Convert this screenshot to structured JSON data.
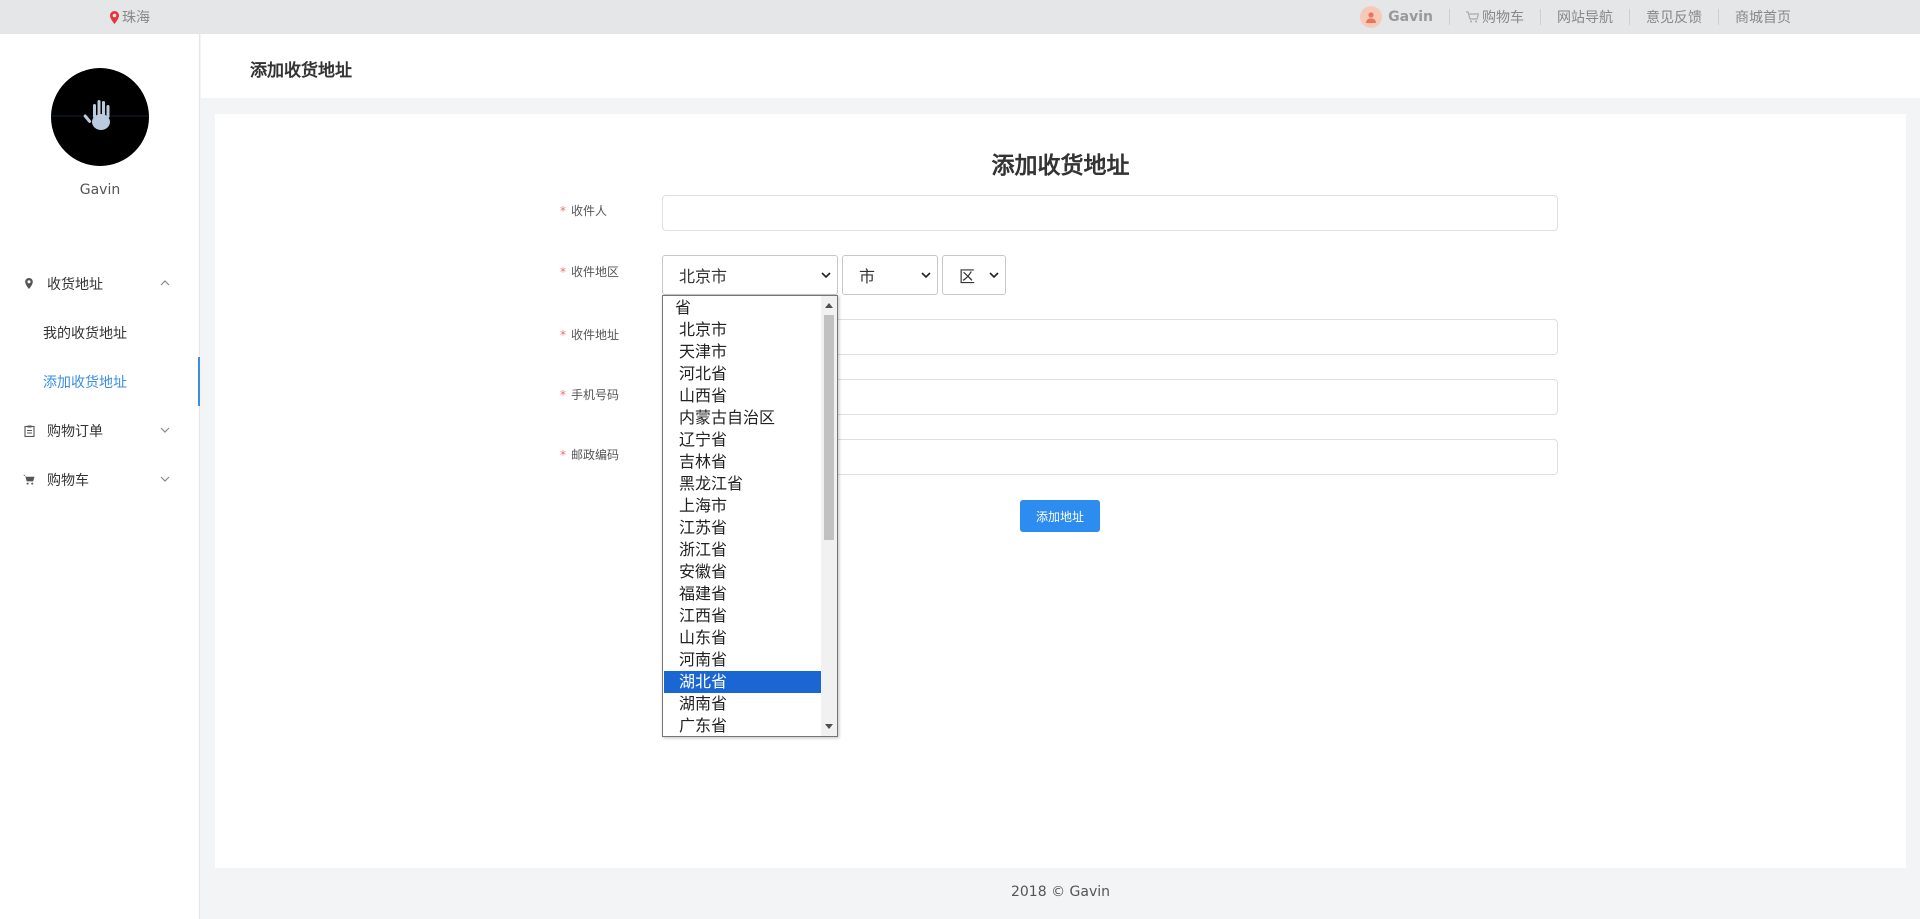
{
  "topbar": {
    "location": "珠海",
    "user": "Gavin",
    "cart": "购物车",
    "sitemap": "网站导航",
    "feedback": "意见反馈",
    "home": "商城首页"
  },
  "sidebar": {
    "username": "Gavin",
    "groups": [
      {
        "label": "收货地址",
        "icon": "map-pin-icon",
        "expanded": true,
        "items": [
          {
            "label": "我的收货地址"
          },
          {
            "label": "添加收货地址",
            "active": true
          }
        ]
      },
      {
        "label": "购物订单",
        "icon": "clipboard-icon",
        "expanded": false
      },
      {
        "label": "购物车",
        "icon": "cart-icon",
        "expanded": false
      }
    ]
  },
  "header": {
    "title": "添加收货地址"
  },
  "form": {
    "title": "添加收货地址",
    "fields": {
      "receiver": {
        "label": "收件人",
        "value": ""
      },
      "region": {
        "label": "收件地区"
      },
      "address": {
        "label": "收件地址",
        "value": ""
      },
      "phone": {
        "label": "手机号码",
        "value": ""
      },
      "zip": {
        "label": "邮政编码",
        "value": ""
      }
    },
    "province_select": {
      "value": "北京市"
    },
    "city_select": {
      "value": "市"
    },
    "district_select": {
      "value": "区"
    },
    "submit_label": "添加地址"
  },
  "dropdown": {
    "options": [
      "省",
      "北京市",
      "天津市",
      "河北省",
      "山西省",
      "内蒙古自治区",
      "辽宁省",
      "吉林省",
      "黑龙江省",
      "上海市",
      "江苏省",
      "浙江省",
      "安徽省",
      "福建省",
      "江西省",
      "山东省",
      "河南省",
      "湖北省",
      "湖南省",
      "广东省"
    ],
    "highlighted": "湖北省"
  },
  "footer": {
    "text": "2018 © Gavin"
  },
  "colors": {
    "accent": "#3a8ee6",
    "button": "#2d8cf0",
    "required": "#f56c6c",
    "highlight": "#1a66d2"
  }
}
